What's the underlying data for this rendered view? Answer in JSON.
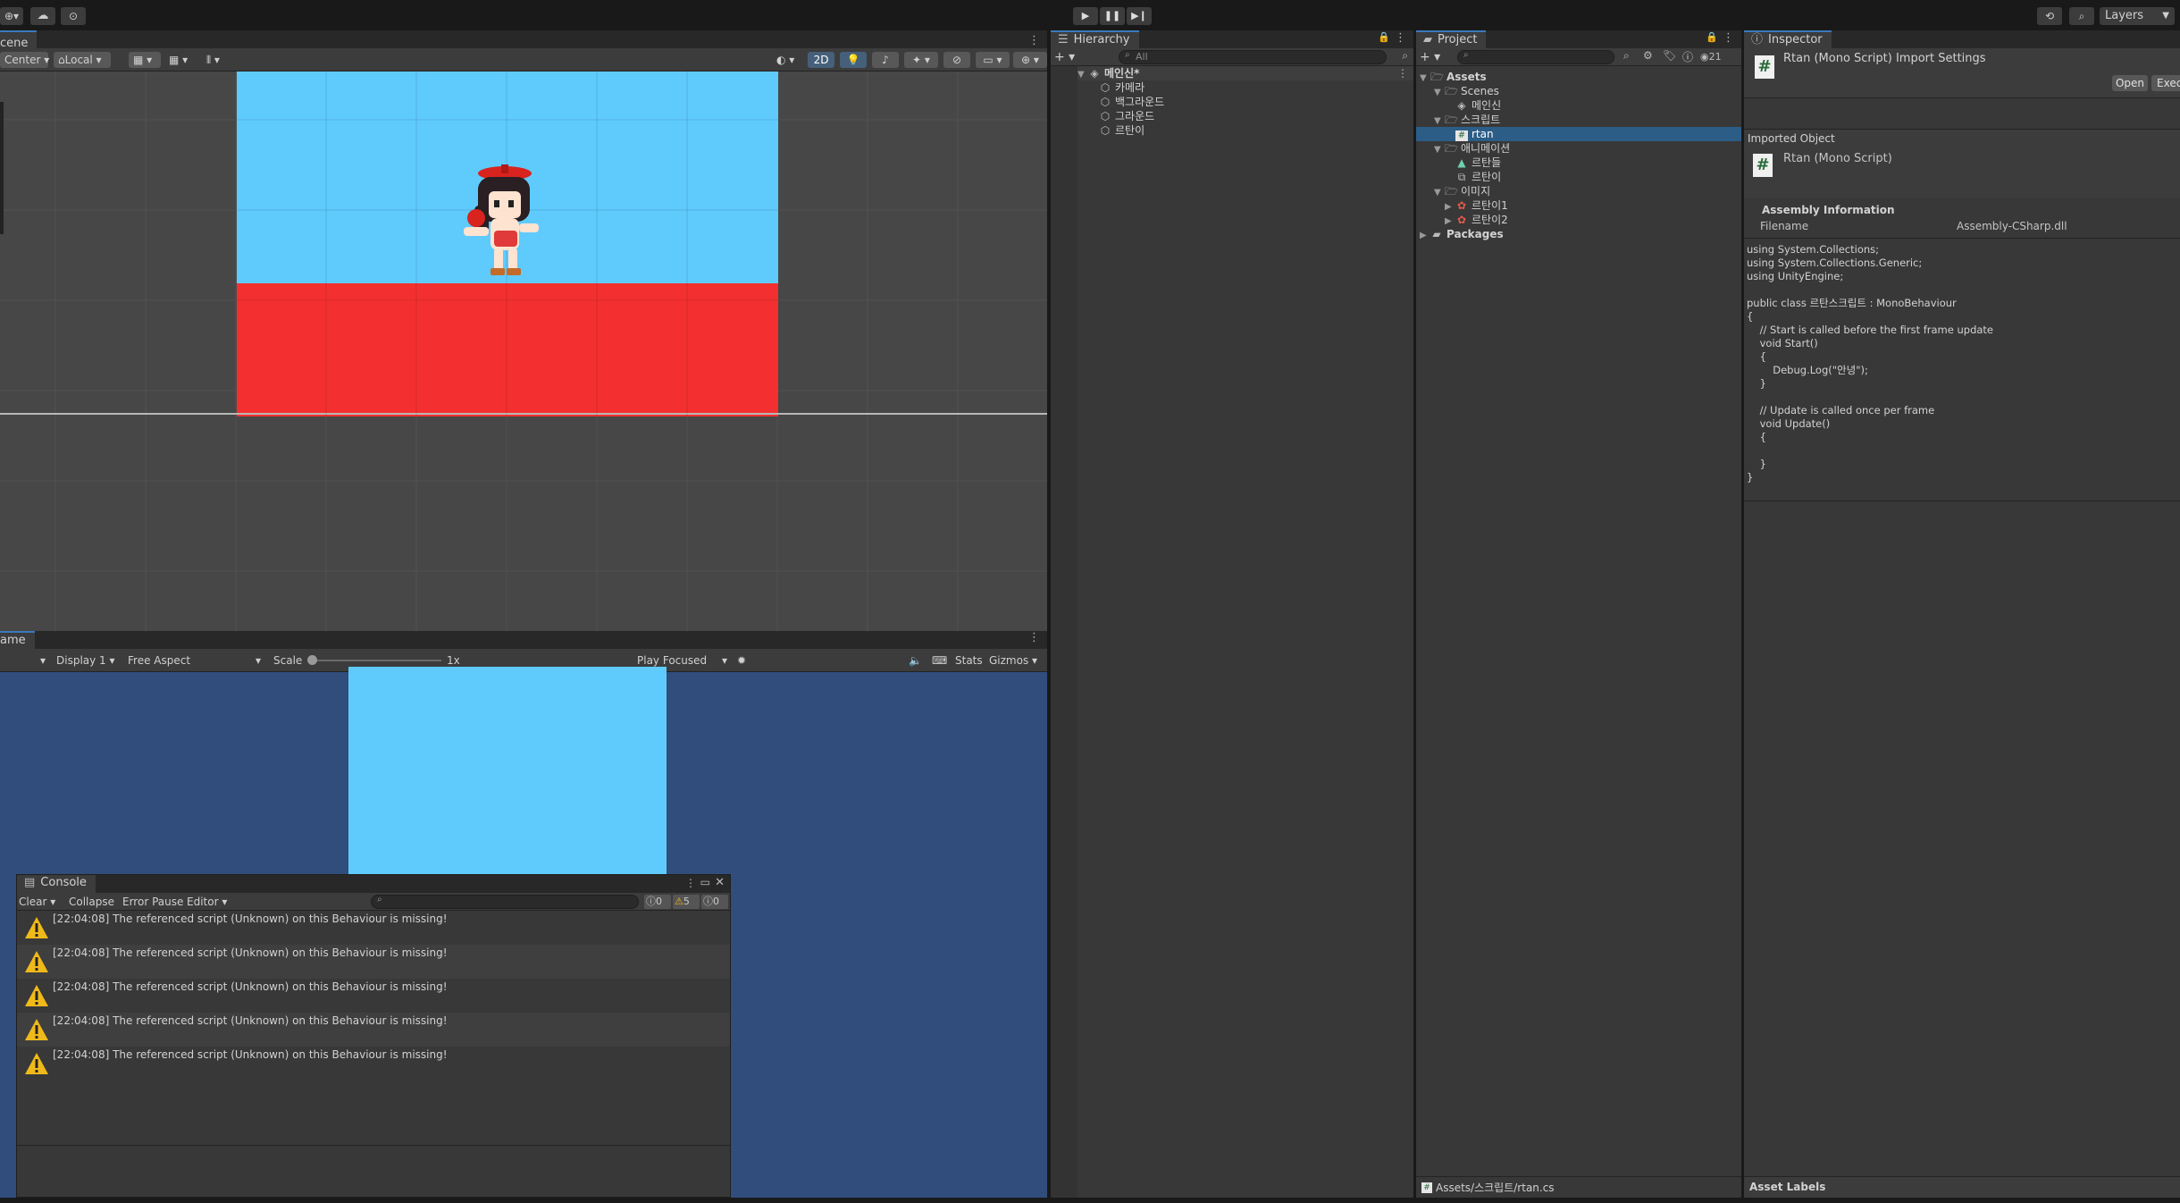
{
  "topbar": {
    "account_label": "⊕",
    "layers_label": "Layers",
    "play_icon": "play-icon",
    "pause_icon": "pause-icon",
    "step_icon": "step-icon"
  },
  "scene": {
    "tab_label": "cene",
    "pivot_label": "Center",
    "space_label": "Local",
    "mode_2d_label": "2D"
  },
  "game": {
    "tab_label": "ame",
    "display_label": "Display 1",
    "aspect_label": "Free Aspect",
    "scale_label": "Scale",
    "scale_value": "1x",
    "play_focused_label": "Play Focused",
    "stats_label": "Stats",
    "gizmos_label": "Gizmos"
  },
  "console": {
    "tab_label": "Console",
    "clear_label": "Clear",
    "collapse_label": "Collapse",
    "error_pause_label": "Error Pause",
    "editor_label": "Editor",
    "count_errors": "0",
    "count_warnings": "5",
    "count_infos": "0",
    "messages": [
      "[22:04:08] The referenced script (Unknown) on this Behaviour is missing!",
      "[22:04:08] The referenced script (Unknown) on this Behaviour is missing!",
      "[22:04:08] The referenced script (Unknown) on this Behaviour is missing!",
      "[22:04:08] The referenced script (Unknown) on this Behaviour is missing!",
      "[22:04:08] The referenced script (Unknown) on this Behaviour is missing!"
    ]
  },
  "hierarchy": {
    "tab_label": "Hierarchy",
    "search_placeholder": "All",
    "scene_name": "메인신*",
    "items": [
      "카메라",
      "백그라운드",
      "그라운드",
      "르탄이"
    ]
  },
  "project": {
    "tab_label": "Project",
    "hidden_count": "21",
    "assets_label": "Assets",
    "scenes_label": "Scenes",
    "scene_item": "메인신",
    "scripts_label": "스크립트",
    "script_item": "rtan",
    "animation_label": "애니메이션",
    "anim_items": [
      "르탄들",
      "르탄이"
    ],
    "images_label": "이미지",
    "image_items": [
      "르탄이1",
      "르탄이2"
    ],
    "packages_label": "Packages",
    "footer_path": "Assets/스크립트/rtan.cs"
  },
  "inspector": {
    "tab_label": "Inspector",
    "title": "Rtan (Mono Script) Import Settings",
    "open_label": "Open",
    "exec_label": "Exec",
    "imported_object_label": "Imported Object",
    "object_name": "Rtan (Mono Script)",
    "assembly_heading": "Assembly Information",
    "filename_label": "Filename",
    "filename_value": "Assembly-CSharp.dll",
    "code": "using System.Collections;\nusing System.Collections.Generic;\nusing UnityEngine;\n\npublic class 르탄스크립트 : MonoBehaviour\n{\n    // Start is called before the first frame update\n    void Start()\n    {\n        Debug.Log(\"안녕\");\n    }\n\n    // Update is called once per frame\n    void Update()\n    {\n\n    }\n}",
    "asset_labels_label": "Asset Labels"
  },
  "colors": {
    "sky": "#5fcbfd",
    "ground": "#f3302f",
    "game_bg": "#304d7c",
    "selection": "#2c5d87"
  }
}
